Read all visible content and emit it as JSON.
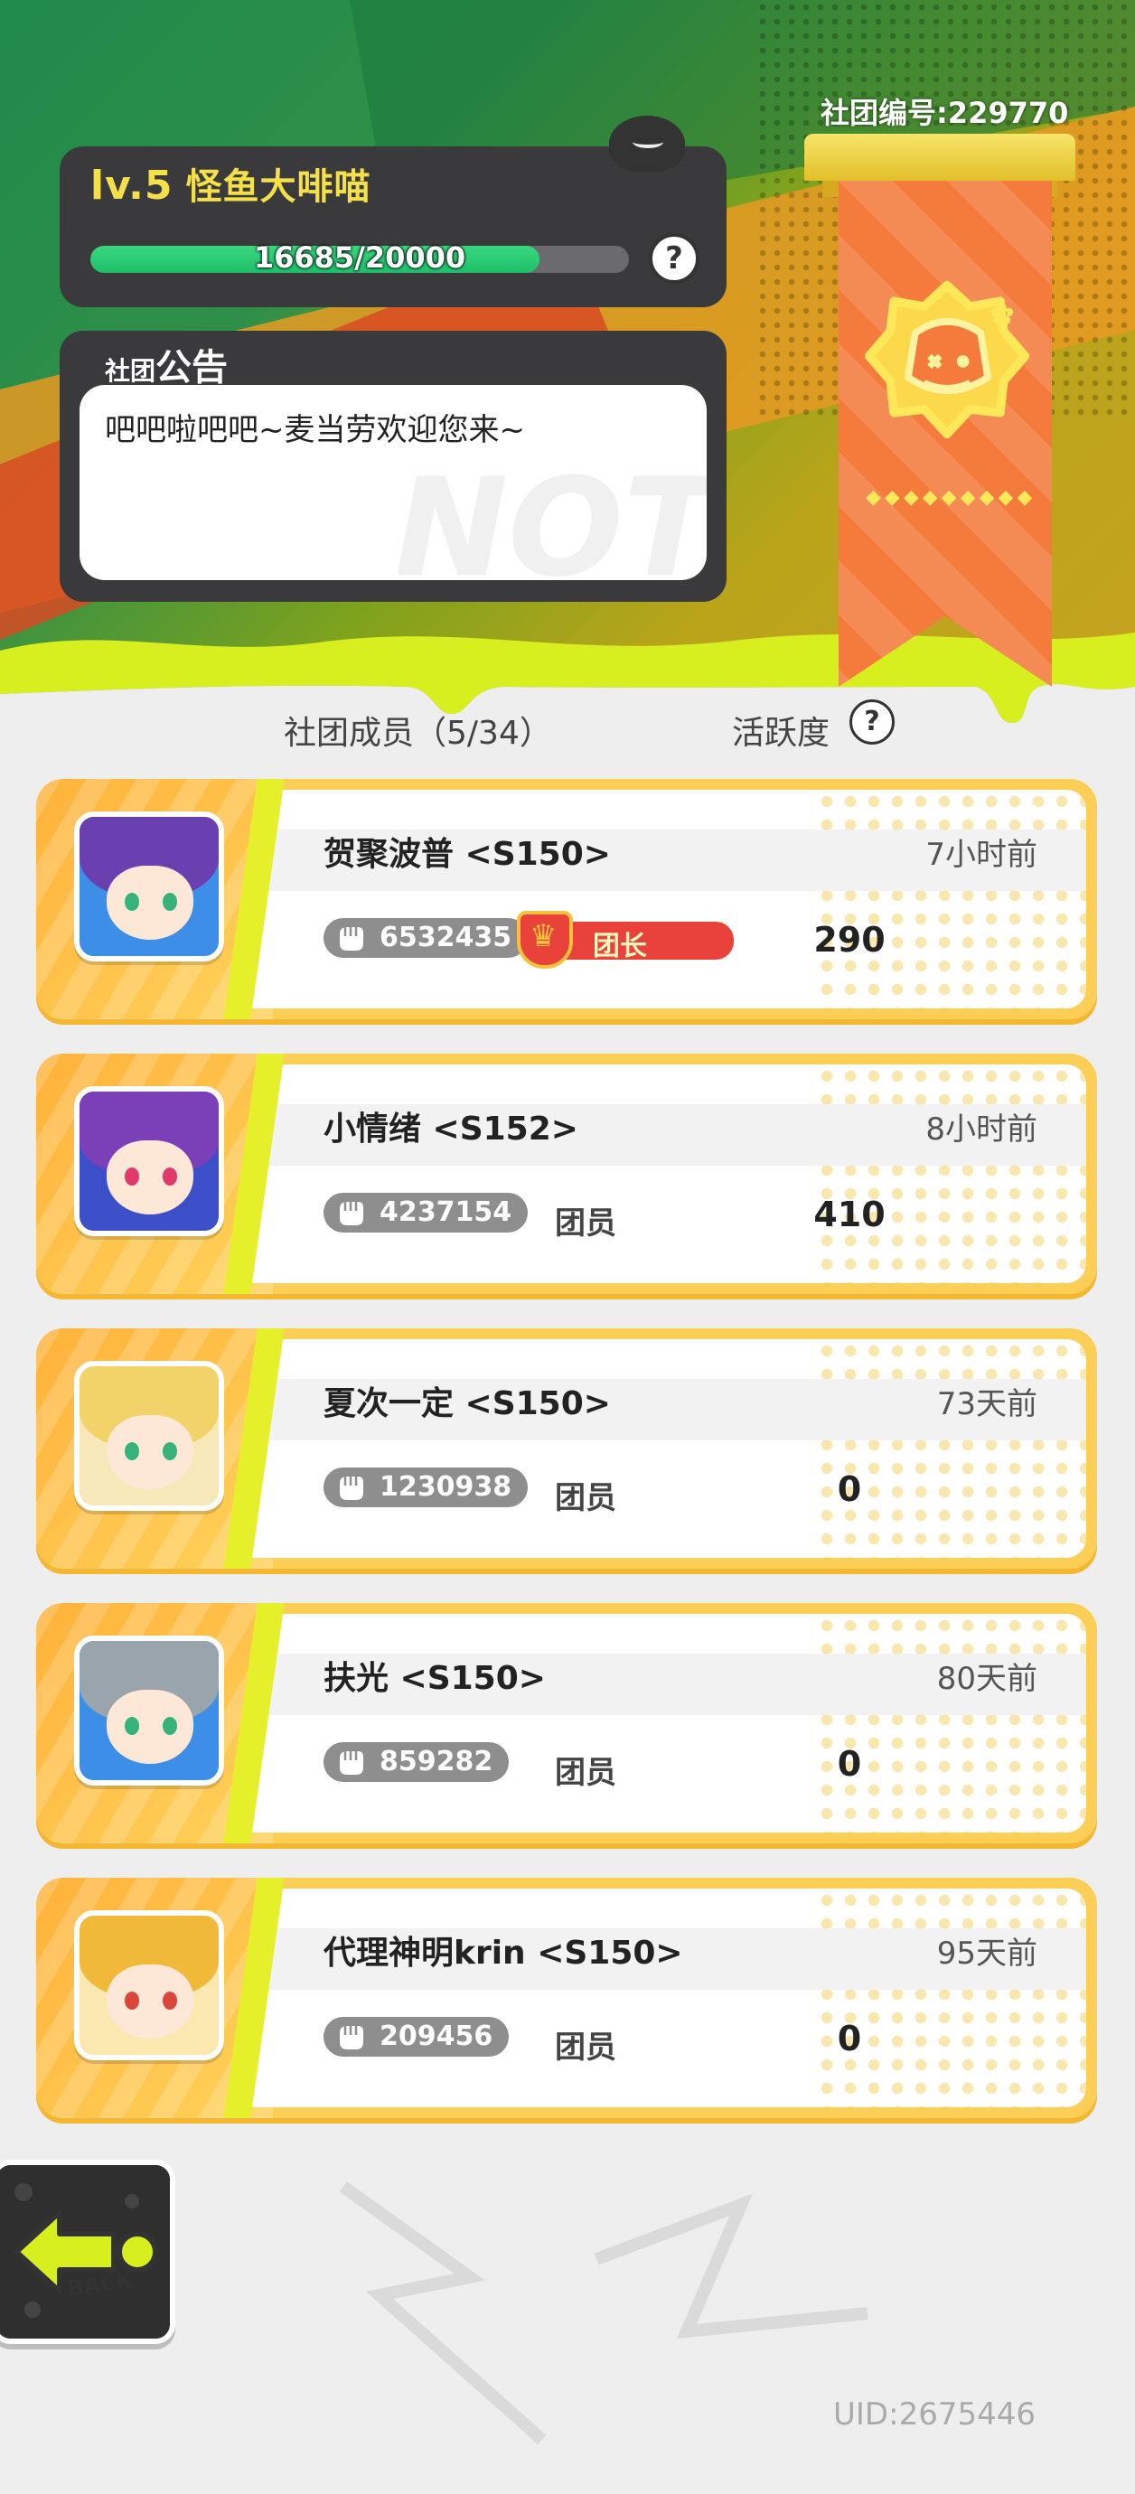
{
  "club": {
    "level": "lv.5",
    "name": "怪鱼大啡喵",
    "exp_text": "16685/20000",
    "exp_fraction": 0.834,
    "id_label": "社团编号:229770",
    "notice_title_small": "社团",
    "notice_title_big": "公告",
    "notice_text": "吧吧啦吧吧~麦当劳欢迎您来~",
    "notice_watermark": "NOT"
  },
  "members": {
    "header": "社团成员（5/34）",
    "activity_header": "活跃度",
    "list": [
      {
        "name": "贺聚波普 <S150>",
        "last_seen": "7小时前",
        "power": "6532435",
        "role": "团长",
        "activity": "290"
      },
      {
        "name": "小情绪 <S152>",
        "last_seen": "8小时前",
        "power": "4237154",
        "role": "团员",
        "activity": "410"
      },
      {
        "name": "夏次一定 <S150>",
        "last_seen": "73天前",
        "power": "1230938",
        "role": "团员",
        "activity": "0"
      },
      {
        "name": "扶光 <S150>",
        "last_seen": "80天前",
        "power": "859282",
        "role": "团员",
        "activity": "0"
      },
      {
        "name": "代理神明krin <S150>",
        "last_seen": "95天前",
        "power": "209456",
        "role": "团员",
        "activity": "0"
      }
    ]
  },
  "back_label": "BACK",
  "uid": "UID:2675446",
  "help_glyph": "?",
  "icons": {
    "help": "question-circle-icon",
    "back": "back-arrow-icon",
    "power": "fist-icon",
    "leader": "crown-shield-icon",
    "emblem": "fish-emblem-icon"
  },
  "colors": {
    "accent_yellow": "#f4e04a",
    "exp_green": "#1fbf6a",
    "banner_orange": "#f47b3c",
    "card_yellow": "#fbcf56",
    "leader_red": "#e8423a",
    "slime_lime": "#d7ee1f"
  }
}
